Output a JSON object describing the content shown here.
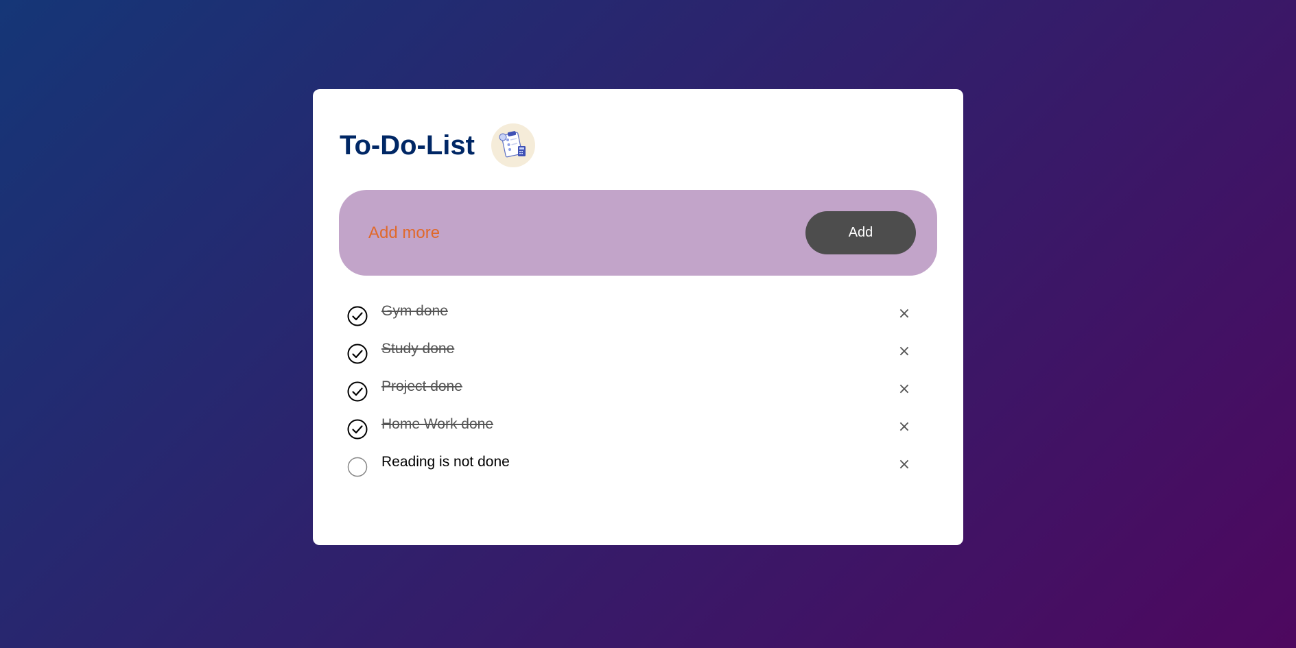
{
  "app": {
    "title": "To-Do-List",
    "logo_icon": "clipboard-checklist-icon"
  },
  "input": {
    "placeholder": "Add more",
    "value": ""
  },
  "add_button": {
    "label": "Add"
  },
  "tasks": [
    {
      "text": "Gym done",
      "done": true
    },
    {
      "text": "Study done",
      "done": true
    },
    {
      "text": "Project done",
      "done": true
    },
    {
      "text": "Home Work done",
      "done": true
    },
    {
      "text": "Reading is not done",
      "done": false
    }
  ],
  "icons": {
    "checked": "checked-circle-icon",
    "unchecked": "empty-circle-icon",
    "remove": "close-icon"
  },
  "colors": {
    "title": "#002765",
    "input_background": "#c2a4c9",
    "placeholder": "#e0692a",
    "button_background": "#4d4d4d",
    "gradient_start": "#153677",
    "gradient_end": "#4e085f"
  }
}
